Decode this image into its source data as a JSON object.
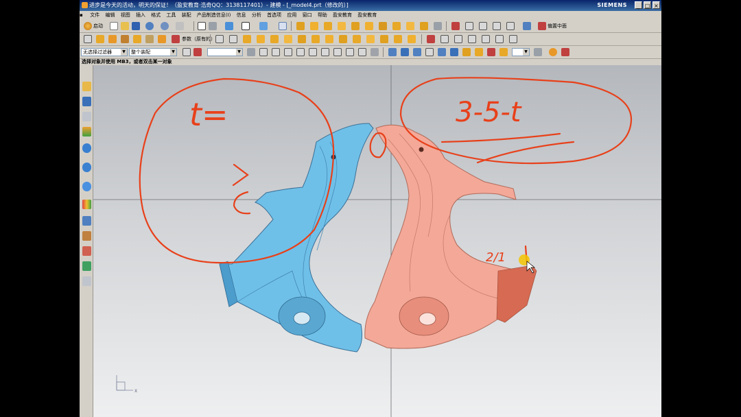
{
  "window": {
    "title": "进步是今天的活动，明天的保证！（盈安教育·浩奇QQ：3138117401）- 建模 - [_model4.prt（修改的）]",
    "brand": "SIEMENS",
    "controls": {
      "minimize": "_",
      "maximize": "□",
      "close": "×"
    }
  },
  "menu": [
    "文件",
    "编辑",
    "视图",
    "插入",
    "格式",
    "工具",
    "装配",
    "产品制造信息(I)",
    "信息",
    "分析",
    "首选项",
    "应用",
    "窗口",
    "帮助",
    "盈安教育",
    "盈安教育"
  ],
  "toolbar": {
    "start_label": "启动",
    "params_label": "参数（原有的）",
    "tail_label": "偏置中面"
  },
  "selection_bar": {
    "filter_value": "无选择过滤器",
    "scope_value": "整个装配",
    "snap_value": ""
  },
  "cue_line": "选择对象并使用 MB3，或者双击某一对象",
  "annotations": {
    "left_text": "t=",
    "right_text": "3-5-t",
    "small_note": "2/1"
  },
  "triad": {
    "x_label": "X"
  },
  "colors": {
    "part_left": "#6fc0e8",
    "part_right": "#f4a898",
    "ink": "#e8401a"
  },
  "icons": {
    "title_logo": "nx-logo-icon",
    "resource_bar": [
      "part-navigator-icon",
      "assembly-navigator-icon",
      "constraint-navigator-icon",
      "reuse-library-icon",
      "hd3d-tools-icon",
      "web-browser-icon",
      "history-icon",
      "system-materials-icon",
      "process-studio-icon",
      "manufacturing-wizard-icon",
      "roles-icon",
      "system-scenes-icon",
      "palette-icon"
    ]
  }
}
